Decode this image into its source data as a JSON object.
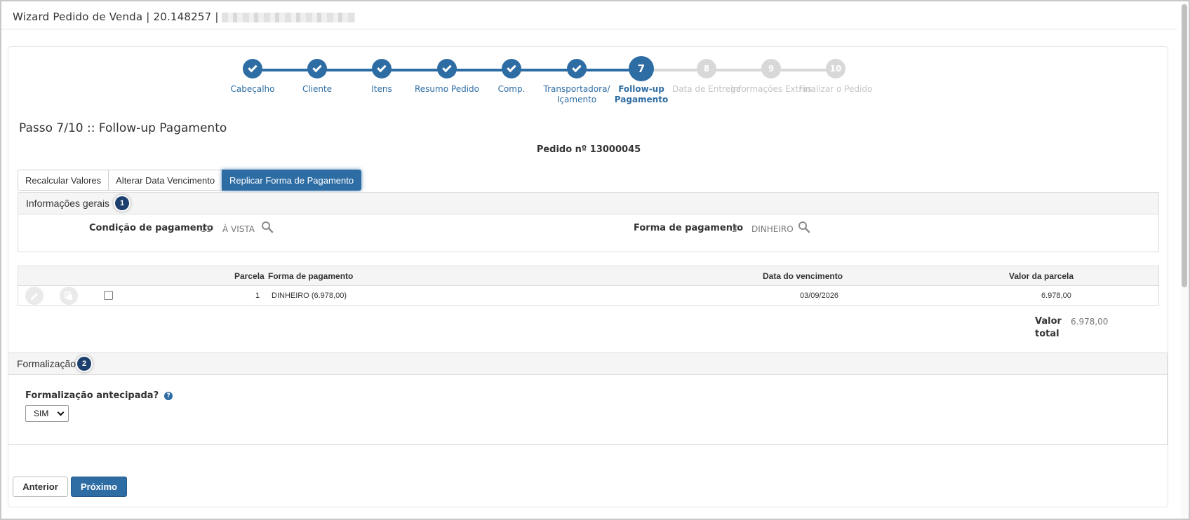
{
  "window": {
    "title": "Wizard Pedido de Venda | 20.148257 |"
  },
  "stepper": {
    "steps": [
      {
        "number": "1",
        "label": "Cabeçalho",
        "state": "done"
      },
      {
        "number": "2",
        "label": "Cliente",
        "state": "done"
      },
      {
        "number": "3",
        "label": "Itens",
        "state": "done"
      },
      {
        "number": "4",
        "label": "Resumo Pedido",
        "state": "done"
      },
      {
        "number": "5",
        "label": "Comp.",
        "state": "done"
      },
      {
        "number": "6",
        "label": "Transportadora/ Içamento",
        "state": "done"
      },
      {
        "number": "7",
        "label": "Follow-up Pagamento",
        "state": "active"
      },
      {
        "number": "8",
        "label": "Data de Entrega",
        "state": "todo"
      },
      {
        "number": "9",
        "label": "Informações Extras",
        "state": "todo"
      },
      {
        "number": "10",
        "label": "Finalizar o Pedido",
        "state": "todo"
      }
    ]
  },
  "page": {
    "step_title": "Passo 7/10 :: Follow-up Pagamento",
    "order_number": "Pedido nº 13000045"
  },
  "tabs": [
    {
      "label": "Recalcular Valores",
      "selected": false
    },
    {
      "label": "Alterar Data Vencimento",
      "selected": false
    },
    {
      "label": "Replicar Forma de Pagamento",
      "selected": true
    }
  ],
  "general_info": {
    "title": "Informações gerais",
    "badge": "1",
    "payment_condition": {
      "label": "Condição de pagamento",
      "code": "11",
      "name": "À VISTA"
    },
    "payment_method": {
      "label": "Forma de pagamento",
      "code": "2",
      "name": "DINHEIRO"
    }
  },
  "installments": {
    "headers": {
      "parcela": "Parcela",
      "forma": "Forma de pagamento",
      "vencimento": "Data do vencimento",
      "valor": "Valor da parcela"
    },
    "rows": [
      {
        "parcela": "1",
        "forma": "DINHEIRO (6.978,00)",
        "vencimento": "03/09/2026",
        "valor": "6.978,00"
      }
    ],
    "total_label": "Valor total",
    "total_value": "6.978,00"
  },
  "formalization": {
    "title": "Formalização",
    "badge": "2",
    "question": "Formalização antecipada?",
    "help_glyph": "?",
    "selected": "SIM"
  },
  "buttons": {
    "previous": "Anterior",
    "next": "Próximo"
  },
  "colors": {
    "primary": "#2e6da4",
    "badge": "#1c3f6e",
    "inactive_step": "#d8d8d8"
  }
}
